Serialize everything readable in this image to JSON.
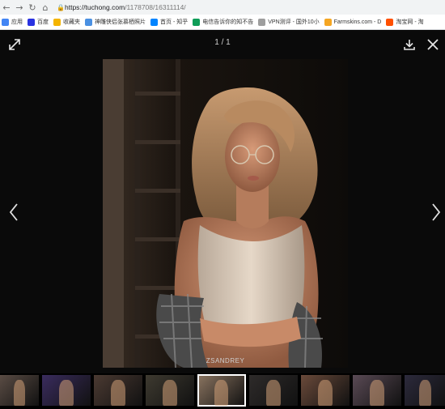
{
  "browser": {
    "url_host": "https://tuchong.com",
    "url_path": "/1178708/16311114/",
    "bookmarks": [
      {
        "label": "应用",
        "color": "#4285f4"
      },
      {
        "label": "百度",
        "color": "#2932e1"
      },
      {
        "label": "收藏夹",
        "color": "#f4b400"
      },
      {
        "label": "神雕侠侣张慕栖照片",
        "color": "#4a90e2"
      },
      {
        "label": "首页 - 知乎",
        "color": "#0084ff"
      },
      {
        "label": "电信告诉你的知不告",
        "color": "#0f9d58"
      },
      {
        "label": "VPN测评 - 国外10小",
        "color": "#9e9e9e"
      },
      {
        "label": "Farmskins.com - D",
        "color": "#f5a623"
      },
      {
        "label": "淘宝网 - 淘",
        "color": "#ff5000"
      }
    ]
  },
  "viewer": {
    "counter": "1 / 1",
    "watermark": "ZSANDREY",
    "icons": {
      "expand": "expand-icon",
      "download": "download-icon",
      "close": "close-icon",
      "prev": "chevron-left-icon",
      "next": "chevron-right-icon"
    },
    "thumbnails": [
      {
        "tone": "#5a4c44",
        "active": false
      },
      {
        "tone": "#3a2c5e",
        "active": false
      },
      {
        "tone": "#4b3a32",
        "active": false
      },
      {
        "tone": "#3e3a30",
        "active": false
      },
      {
        "tone": "#8a7460",
        "active": true
      },
      {
        "tone": "#2e2b2a",
        "active": false
      },
      {
        "tone": "#6a4a3a",
        "active": false
      },
      {
        "tone": "#5a4a55",
        "active": false
      },
      {
        "tone": "#2c2a3c",
        "active": false
      }
    ]
  }
}
